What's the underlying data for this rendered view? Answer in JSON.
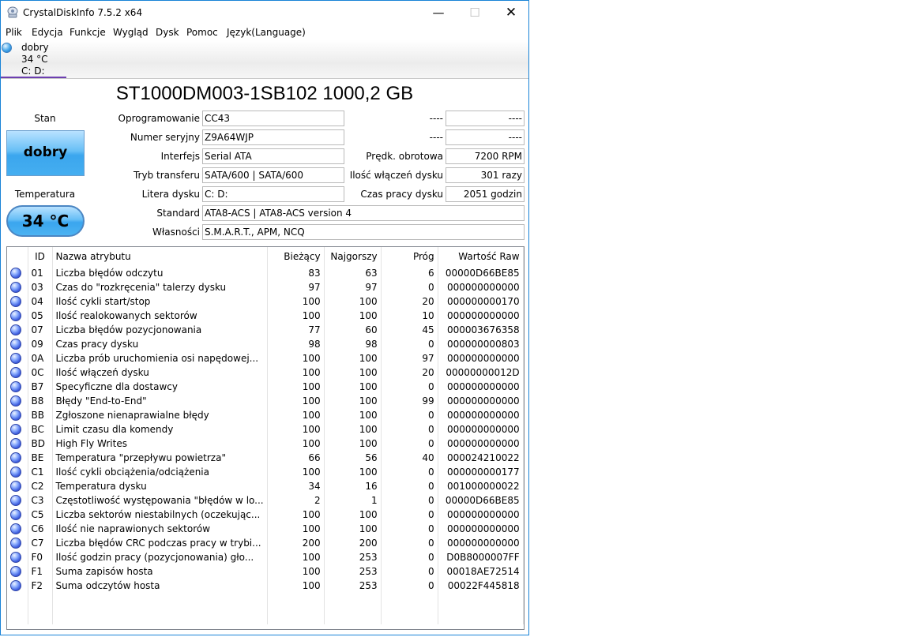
{
  "window": {
    "title": "CrystalDiskInfo 7.5.2 x64",
    "controls": {
      "minimize": "—",
      "maximize": "☐",
      "close": "✕"
    }
  },
  "menu": [
    "Plik",
    "Edycja",
    "Funkcje",
    "Wygląd",
    "Dysk",
    "Pomoc",
    "Język(Language)"
  ],
  "drive_tab": {
    "status": "dobry",
    "temperature": "34 °C",
    "letters": "C: D:"
  },
  "model": "ST1000DM003-1SB102 1000,2 GB",
  "health": {
    "label": "Stan",
    "value": "dobry",
    "color": "#45aef0"
  },
  "temperature": {
    "label": "Temperatura",
    "value": "34 °C"
  },
  "info": {
    "firmware": {
      "label": "Oprogramowanie",
      "value": "CC43"
    },
    "serial": {
      "label": "Numer seryjny",
      "value": "Z9A64WJP"
    },
    "interface": {
      "label": "Interfejs",
      "value": "Serial ATA"
    },
    "transfer": {
      "label": "Tryb transferu",
      "value": "SATA/600 | SATA/600"
    },
    "drive_letter": {
      "label": "Litera dysku",
      "value": "C: D:"
    },
    "standard": {
      "label": "Standard",
      "value": "ATA8-ACS | ATA8-ACS version 4"
    },
    "features": {
      "label": "Własności",
      "value": "S.M.A.R.T., APM, NCQ"
    },
    "extra1": {
      "label": "----",
      "value": "----"
    },
    "extra2": {
      "label": "----",
      "value": "----"
    },
    "rpm": {
      "label": "Prędk. obrotowa",
      "value": "7200 RPM"
    },
    "power_count": {
      "label": "Ilość włączeń dysku",
      "value": "301 razy"
    },
    "power_hours": {
      "label": "Czas pracy dysku",
      "value": "2051 godzin"
    }
  },
  "smart": {
    "headers": [
      "",
      "ID",
      "Nazwa atrybutu",
      "Bieżący",
      "Najgorszy",
      "Próg",
      "Wartość Raw"
    ],
    "rows": [
      [
        "01",
        "Liczba błędów odczytu",
        "83",
        "63",
        "6",
        "00000D66BE85"
      ],
      [
        "03",
        "Czas do \"rozkręcenia\" talerzy dysku",
        "97",
        "97",
        "0",
        "000000000000"
      ],
      [
        "04",
        "Ilość cykli start/stop",
        "100",
        "100",
        "20",
        "000000000170"
      ],
      [
        "05",
        "Ilość realokowanych sektorów",
        "100",
        "100",
        "10",
        "000000000000"
      ],
      [
        "07",
        "Liczba błędów pozycjonowania",
        "77",
        "60",
        "45",
        "000003676358"
      ],
      [
        "09",
        "Czas pracy dysku",
        "98",
        "98",
        "0",
        "000000000803"
      ],
      [
        "0A",
        "Liczba prób uruchomienia osi napędowej...",
        "100",
        "100",
        "97",
        "000000000000"
      ],
      [
        "0C",
        "Ilość włączeń dysku",
        "100",
        "100",
        "20",
        "00000000012D"
      ],
      [
        "B7",
        "Specyficzne dla dostawcy",
        "100",
        "100",
        "0",
        "000000000000"
      ],
      [
        "B8",
        "Błędy \"End-to-End\"",
        "100",
        "100",
        "99",
        "000000000000"
      ],
      [
        "BB",
        "Zgłoszone nienaprawialne błędy",
        "100",
        "100",
        "0",
        "000000000000"
      ],
      [
        "BC",
        "Limit czasu dla komendy",
        "100",
        "100",
        "0",
        "000000000000"
      ],
      [
        "BD",
        "High Fly Writes",
        "100",
        "100",
        "0",
        "000000000000"
      ],
      [
        "BE",
        "Temperatura \"przepływu powietrza\"",
        "66",
        "56",
        "40",
        "000024210022"
      ],
      [
        "C1",
        "Ilość cykli obciążenia/odciążenia",
        "100",
        "100",
        "0",
        "000000000177"
      ],
      [
        "C2",
        "Temperatura dysku",
        "34",
        "16",
        "0",
        "001000000022"
      ],
      [
        "C3",
        "Częstotliwość występowania \"błędów w lo...",
        "2",
        "1",
        "0",
        "00000D66BE85"
      ],
      [
        "C5",
        "Liczba sektorów niestabilnych (oczekując...",
        "100",
        "100",
        "0",
        "000000000000"
      ],
      [
        "C6",
        "Ilość nie naprawionych sektorów",
        "100",
        "100",
        "0",
        "000000000000"
      ],
      [
        "C7",
        "Liczba błędów CRC podczas pracy w trybi...",
        "200",
        "200",
        "0",
        "000000000000"
      ],
      [
        "F0",
        "Ilość godzin pracy (pozycjonowania) gło...",
        "100",
        "253",
        "0",
        "D0B8000007FF"
      ],
      [
        "F1",
        "Suma zapisów hosta",
        "100",
        "253",
        "0",
        "00018AE72514"
      ],
      [
        "F2",
        "Suma odczytów hosta",
        "100",
        "253",
        "0",
        "00022F445818"
      ]
    ]
  }
}
